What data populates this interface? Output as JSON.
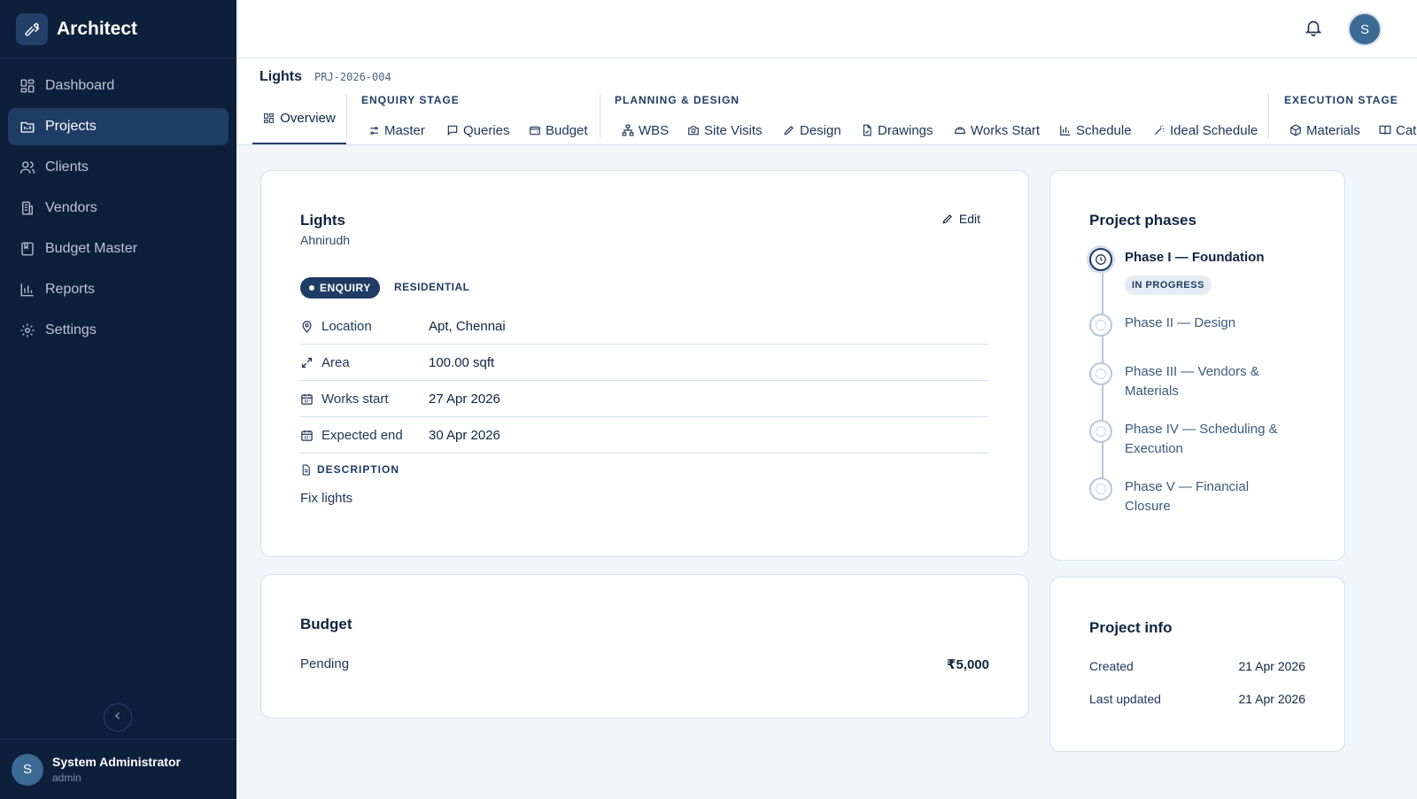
{
  "app": {
    "name": "Architect"
  },
  "sidebar": {
    "items": [
      {
        "label": "Dashboard",
        "icon": "dashboard-icon",
        "active": false
      },
      {
        "label": "Projects",
        "icon": "projects-icon",
        "active": true
      },
      {
        "label": "Clients",
        "icon": "clients-icon",
        "active": false
      },
      {
        "label": "Vendors",
        "icon": "vendors-icon",
        "active": false
      },
      {
        "label": "Budget Master",
        "icon": "budget-master-icon",
        "active": false
      },
      {
        "label": "Reports",
        "icon": "reports-icon",
        "active": false
      },
      {
        "label": "Settings",
        "icon": "settings-icon",
        "active": false
      }
    ],
    "user": {
      "initial": "S",
      "name": "System Administrator",
      "role": "admin"
    }
  },
  "topbar": {
    "avatar_initial": "S"
  },
  "project": {
    "title": "Lights",
    "code": "PRJ-2026-004",
    "tabs": {
      "overview": "Overview",
      "enquiry_label": "ENQUIRY STAGE",
      "enquiry": [
        "Master",
        "Queries",
        "Budget"
      ],
      "planning_label": "PLANNING & DESIGN",
      "planning": [
        "WBS",
        "Site Visits",
        "Design",
        "Drawings",
        "Works Start",
        "Schedule",
        "Ideal Schedule"
      ],
      "execution_label": "EXECUTION STAGE",
      "execution": [
        "Materials",
        "Cat"
      ]
    }
  },
  "overview": {
    "title": "Lights",
    "client": "Ahnirudh",
    "edit_label": "Edit",
    "status_badge": "ENQUIRY",
    "type_badge": "RESIDENTIAL",
    "rows": [
      {
        "label": "Location",
        "value": "Apt, Chennai",
        "icon": "location-pin-icon"
      },
      {
        "label": "Area",
        "value": "100.00 sqft",
        "icon": "expand-arrows-icon"
      },
      {
        "label": "Works start",
        "value": "27 Apr 2026",
        "icon": "calendar-icon"
      },
      {
        "label": "Expected end",
        "value": "30 Apr 2026",
        "icon": "calendar-icon"
      }
    ],
    "description_label": "DESCRIPTION",
    "description": "Fix lights"
  },
  "budget": {
    "title": "Budget",
    "label": "Pending",
    "amount": "₹5,000"
  },
  "phases": {
    "title": "Project phases",
    "status": "IN PROGRESS",
    "items": [
      {
        "line1": "Phase I — Foundation",
        "line2": "",
        "current": true
      },
      {
        "line1": "Phase II — Design",
        "line2": "",
        "current": false
      },
      {
        "line1": "Phase III — Vendors &",
        "line2": "Materials",
        "current": false
      },
      {
        "line1": "Phase IV — Scheduling &",
        "line2": "Execution",
        "current": false
      },
      {
        "line1": "Phase V — Financial",
        "line2": "Closure",
        "current": false
      }
    ]
  },
  "project_info": {
    "title": "Project info",
    "created_label": "Created",
    "created": "21 Apr 2026",
    "updated_label": "Last updated",
    "updated": "21 Apr 2026"
  },
  "colors": {
    "sidebar_bg": "#0e1f3b",
    "accent": "#1f3c65",
    "page_bg": "#f3f6f9"
  }
}
